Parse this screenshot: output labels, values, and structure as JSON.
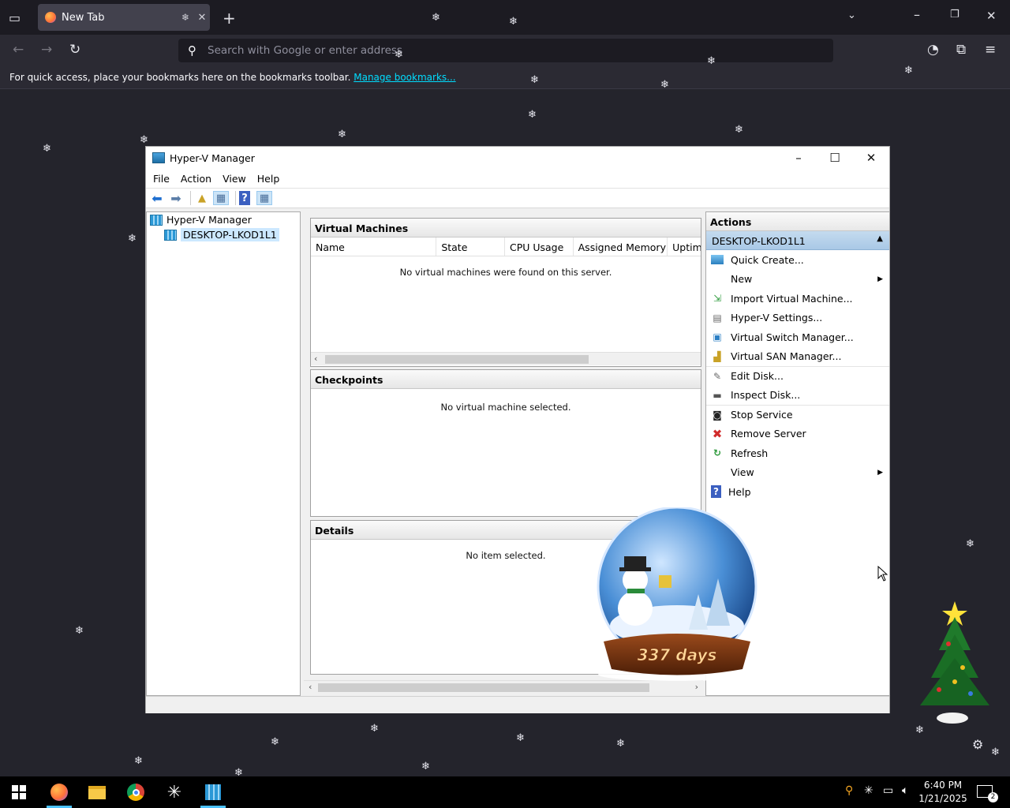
{
  "browser": {
    "tab_title": "New Tab",
    "url_placeholder": "Search with Google or enter address",
    "bookmarks_msg": "For quick access, place your bookmarks here on the bookmarks toolbar.",
    "bookmarks_link": "Manage bookmarks..."
  },
  "hyperv": {
    "title": "Hyper-V Manager",
    "menu": [
      "File",
      "Action",
      "View",
      "Help"
    ],
    "tree": {
      "root": "Hyper-V Manager",
      "server": "DESKTOP-LKOD1L1"
    },
    "vm_pane": {
      "title": "Virtual Machines",
      "columns": [
        "Name",
        "State",
        "CPU Usage",
        "Assigned Memory",
        "Uptim"
      ],
      "empty_msg": "No virtual machines were found on this server."
    },
    "checkpoints": {
      "title": "Checkpoints",
      "empty_msg": "No virtual machine selected."
    },
    "details": {
      "title": "Details",
      "empty_msg": "No item selected."
    },
    "actions": {
      "title": "Actions",
      "group": "DESKTOP-LKOD1L1",
      "items": [
        {
          "label": "Quick Create...",
          "icon": "quick-create-icon"
        },
        {
          "label": "New",
          "icon": "",
          "submenu": true
        },
        {
          "label": "Import Virtual Machine...",
          "icon": "import-vm-icon"
        },
        {
          "label": "Hyper-V Settings...",
          "icon": "settings-icon"
        },
        {
          "label": "Virtual Switch Manager...",
          "icon": "switch-manager-icon"
        },
        {
          "label": "Virtual SAN Manager...",
          "icon": "san-manager-icon"
        },
        {
          "label": "Edit Disk...",
          "icon": "edit-disk-icon"
        },
        {
          "label": "Inspect Disk...",
          "icon": "inspect-disk-icon"
        },
        {
          "label": "Stop Service",
          "icon": "stop-icon"
        },
        {
          "label": "Remove Server",
          "icon": "remove-icon"
        },
        {
          "label": "Refresh",
          "icon": "refresh-icon"
        },
        {
          "label": "View",
          "icon": "",
          "submenu": true
        },
        {
          "label": "Help",
          "icon": "help-icon"
        }
      ]
    }
  },
  "snowglobe_text": "337 days",
  "taskbar": {
    "time": "6:40 PM",
    "date": "1/21/2025",
    "notification_count": "2"
  },
  "colors": {
    "desktop_bg": "#24242c",
    "actions_group_bg": "#b7d1ea",
    "accent": "#4cc2ff"
  }
}
